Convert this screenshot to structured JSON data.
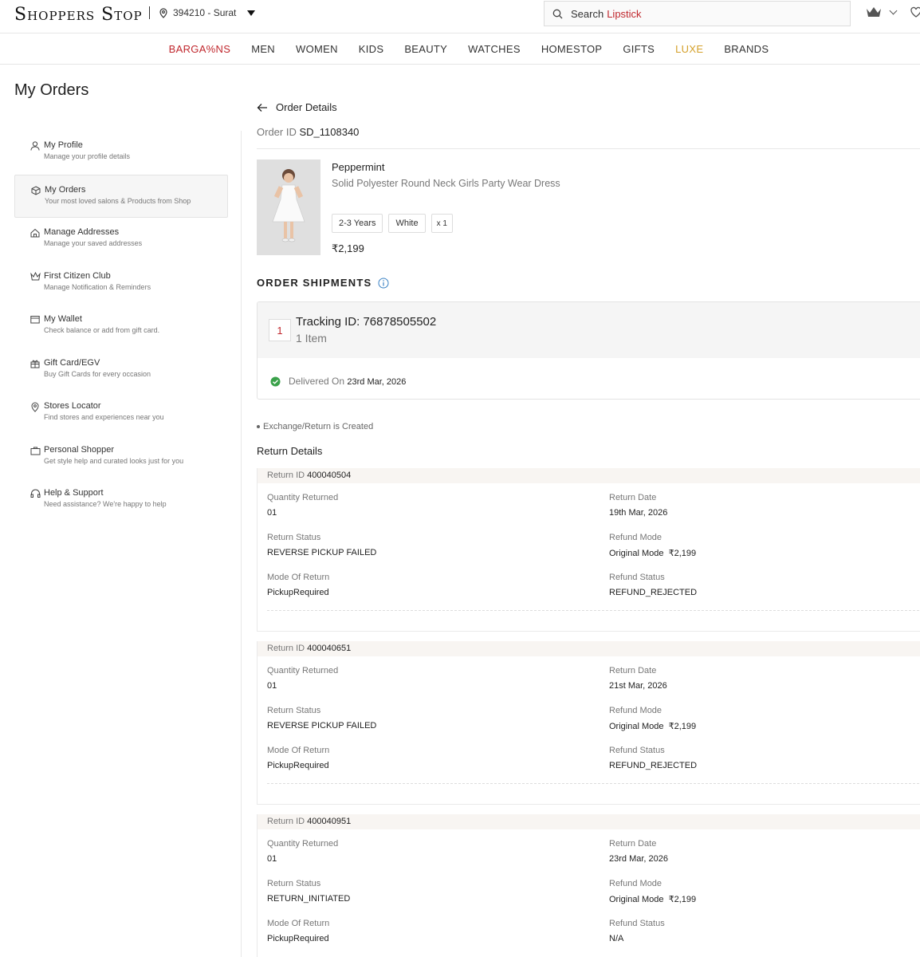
{
  "header": {
    "logo": "Shoppers Stop",
    "location": "394210 - Surat",
    "search_prefix": "Search",
    "search_highlight": "Lipstick"
  },
  "nav": [
    "BARGA%NS",
    "MEN",
    "WOMEN",
    "KIDS",
    "BEAUTY",
    "WATCHES",
    "HOMESTOP",
    "GIFTS",
    "LUXE",
    "BRANDS"
  ],
  "page_title": "My Orders",
  "sidebar": [
    {
      "label": "My Profile",
      "sub": "Manage your profile details",
      "icon": "user-icon"
    },
    {
      "label": "My Orders",
      "sub": "Your most loved salons & Products from Shop",
      "icon": "box-icon",
      "active": true
    },
    {
      "label": "Manage Addresses",
      "sub": "Manage your saved addresses",
      "icon": "home-icon"
    },
    {
      "label": "First Citizen Club",
      "sub": "Manage Notification & Reminders",
      "icon": "crown-icon"
    },
    {
      "label": "My Wallet",
      "sub": "Check balance or add from gift card.",
      "icon": "wallet-icon"
    },
    {
      "label": "Gift Card/EGV",
      "sub": "Buy Gift Cards for every occasion",
      "icon": "gift-icon"
    },
    {
      "label": "Stores Locator",
      "sub": "Find stores and experiences near you",
      "icon": "pin-icon"
    },
    {
      "label": "Personal Shopper",
      "sub": "Get style help and curated looks just for you",
      "icon": "bag-icon"
    },
    {
      "label": "Help & Support",
      "sub": "Need assistance? We're happy to help",
      "icon": "headset-icon"
    }
  ],
  "order": {
    "back_label": "Order Details",
    "id_label": "Order ID",
    "id_value": "SD_1108340",
    "product": {
      "brand": "Peppermint",
      "name": "Solid Polyester Round Neck Girls Party Wear Dress",
      "size": "2-3 Years",
      "color": "White",
      "qty": "x 1",
      "price": "₹2,199"
    }
  },
  "shipments": {
    "title": "ORDER SHIPMENTS",
    "number": "1",
    "tracking": "Tracking ID: 76878505502",
    "items": "1 Item",
    "delivered_label": "Delivered On",
    "delivered_date": "23rd Mar, 2026"
  },
  "exchange_note": "Exchange/Return is Created",
  "return_title": "Return Details",
  "labels": {
    "return_id": "Return ID",
    "qty": "Quantity Returned",
    "date": "Return Date",
    "status": "Return Status",
    "refund_mode": "Refund Mode",
    "mode": "Mode Of Return",
    "refund_status": "Refund Status"
  },
  "returns": [
    {
      "id": "400040504",
      "qty": "01",
      "date": "19th Mar, 2026",
      "status": "REVERSE PICKUP FAILED",
      "refund_mode": "Original Mode  ₹2,199",
      "mode": "PickupRequired",
      "refund_status": "REFUND_REJECTED"
    },
    {
      "id": "400040651",
      "qty": "01",
      "date": "21st Mar, 2026",
      "status": "REVERSE PICKUP FAILED",
      "refund_mode": "Original Mode  ₹2,199",
      "mode": "PickupRequired",
      "refund_status": "REFUND_REJECTED"
    },
    {
      "id": "400040951",
      "qty": "01",
      "date": "23rd Mar, 2026",
      "status": "RETURN_INITIATED",
      "refund_mode": "Original Mode  ₹2,199",
      "mode": "PickupRequired",
      "refund_status": "N/A"
    }
  ],
  "colors": {
    "accent": "#c0272d",
    "luxe": "#d4a02a",
    "success": "#3aa14a",
    "info": "#3b82c4"
  }
}
